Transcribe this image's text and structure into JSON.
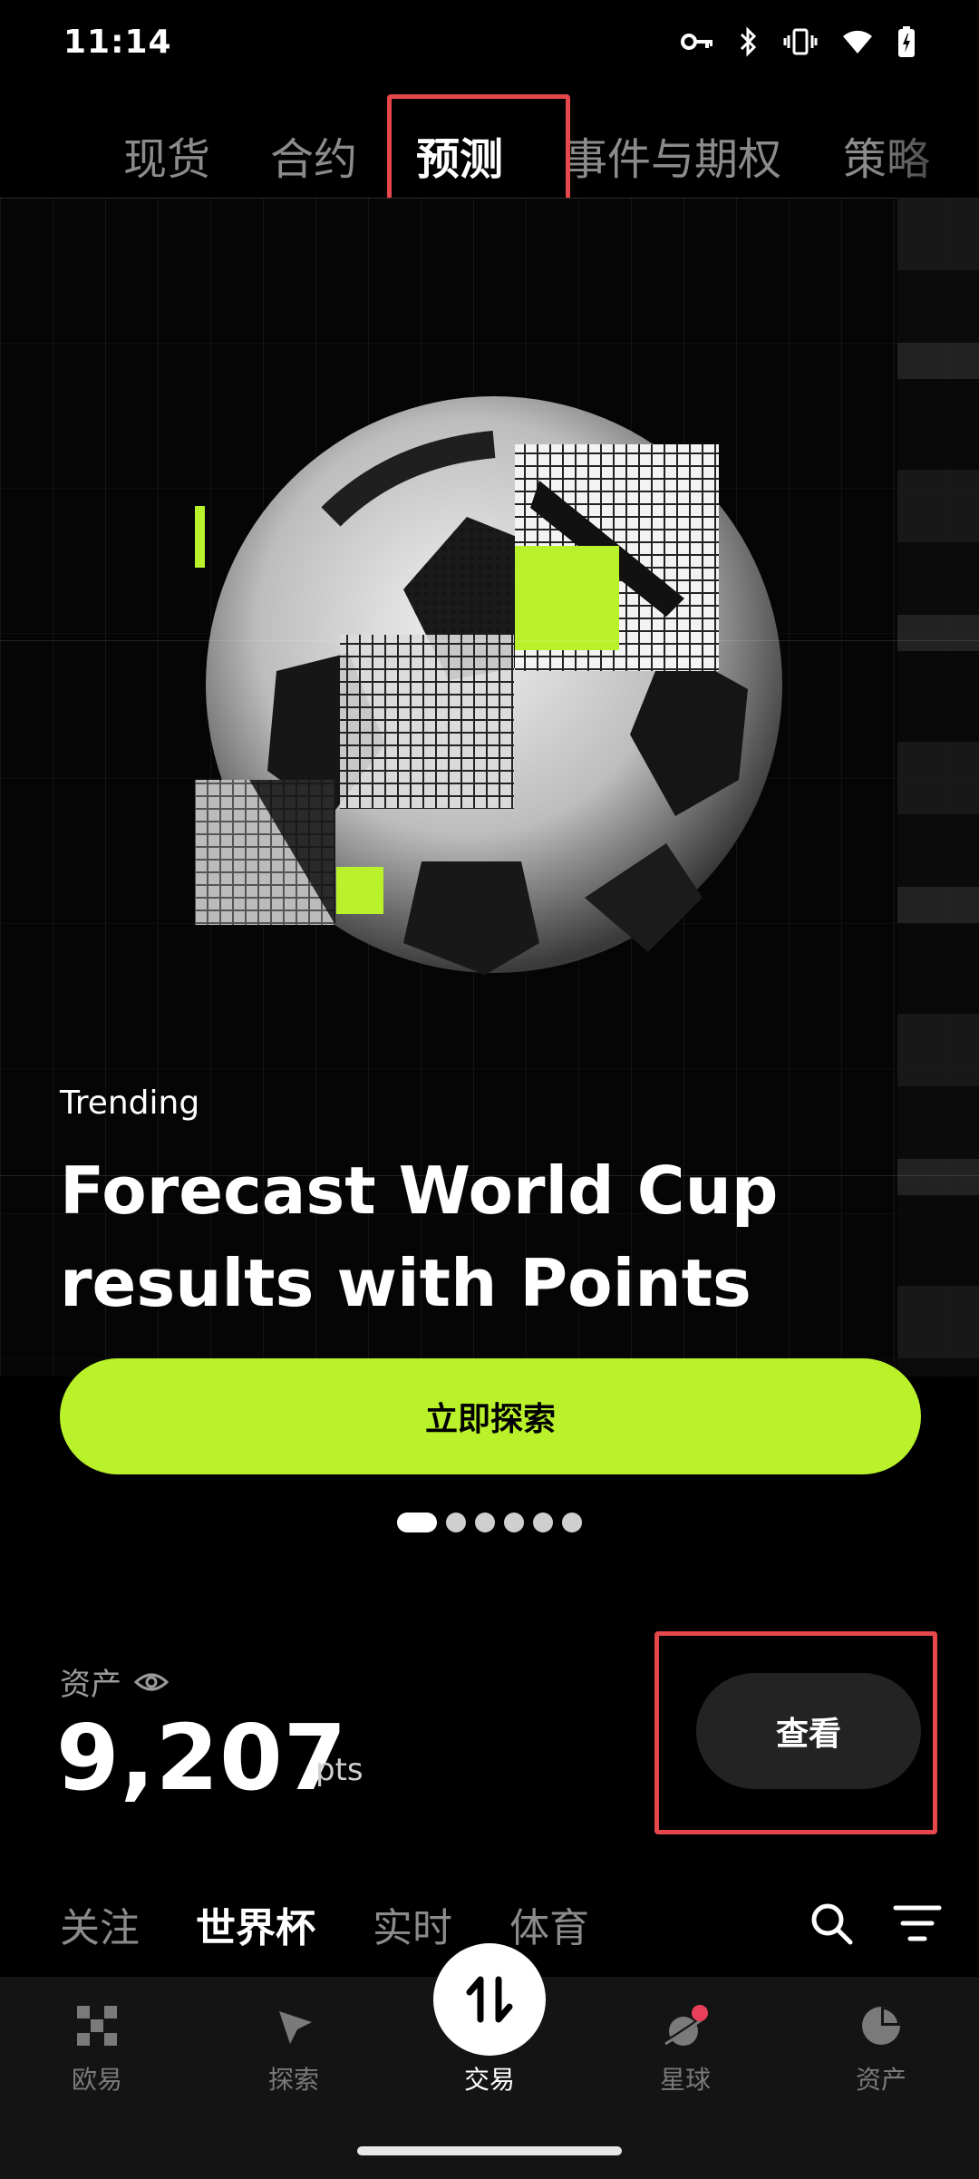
{
  "status_bar": {
    "time": "11:14"
  },
  "top_tabs": [
    {
      "label": "现货"
    },
    {
      "label": "合约"
    },
    {
      "label": "预测"
    },
    {
      "label": "事件与期权"
    },
    {
      "label": "策略"
    }
  ],
  "hero": {
    "tag": "Trending",
    "headline": "Forecast World Cup results with Points",
    "cta_label": "立即探索",
    "carousel_pages": 6,
    "carousel_active_index": 0
  },
  "assets": {
    "label": "资产",
    "value": "9,207",
    "unit": "pts",
    "view_button": "查看"
  },
  "sub_tabs": [
    {
      "label": "关注"
    },
    {
      "label": "世界杯"
    },
    {
      "label": "实时"
    },
    {
      "label": "体育"
    }
  ],
  "bottom_nav": [
    {
      "label": "欧易",
      "icon": "okx-logo-icon"
    },
    {
      "label": "探索",
      "icon": "compass-icon"
    },
    {
      "label": "交易",
      "icon": "trade-arrows-icon"
    },
    {
      "label": "星球",
      "icon": "planet-icon"
    },
    {
      "label": "资产",
      "icon": "pie-chart-icon"
    }
  ],
  "colors": {
    "accent": "#b9f22b",
    "background": "#000000",
    "highlight_outline": "#e5474b",
    "notification_dot": "#e8405a"
  }
}
